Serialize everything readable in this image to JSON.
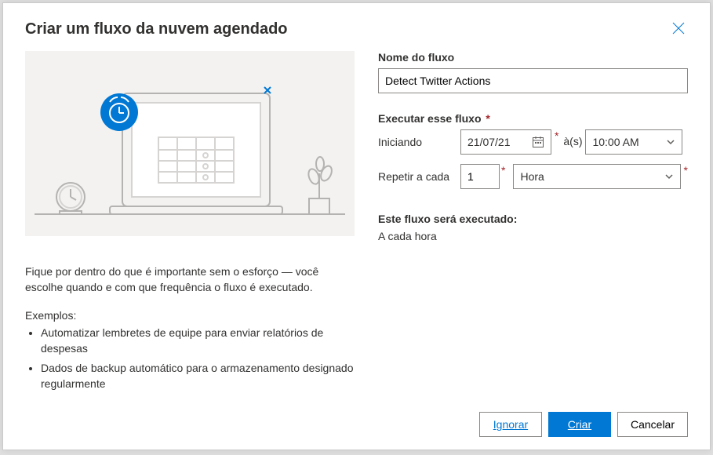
{
  "header": {
    "title": "Criar um fluxo da nuvem agendado"
  },
  "left": {
    "intro": "Fique por dentro do que é importante sem o esforço — você escolhe quando e com que frequência o fluxo é executado.",
    "examples_label": "Exemplos:",
    "examples": [
      "Automatizar lembretes de equipe para enviar relatórios de despesas",
      "Dados de backup automático para o armazenamento designado regularmente"
    ]
  },
  "form": {
    "flow_name_label": "Nome do fluxo",
    "flow_name_value": "Detect Twitter Actions",
    "run_label": "Executar esse fluxo",
    "starting_label": "Iniciando",
    "start_date": "21/07/21",
    "at_label": "à(s)",
    "start_time": "10:00 AM",
    "repeat_label": "Repetir a cada",
    "repeat_value": "1",
    "repeat_unit": "Hora",
    "summary_label": "Este fluxo será executado:",
    "summary_text": "A cada hora"
  },
  "footer": {
    "skip": "Ignorar",
    "create": "Criar",
    "cancel": "Cancelar"
  }
}
